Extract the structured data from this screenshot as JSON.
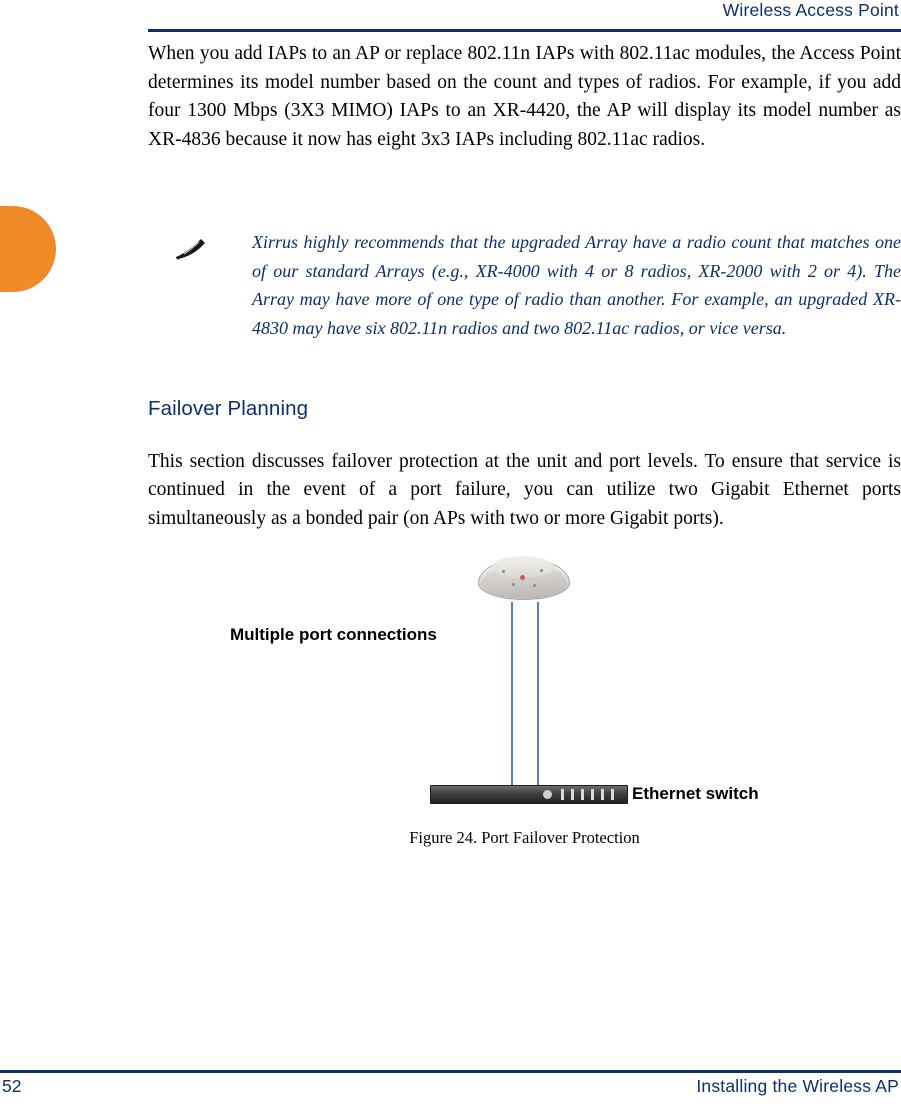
{
  "header": {
    "title": "Wireless Access Point"
  },
  "body": {
    "paragraph1": "When you add IAPs to an AP or replace 802.11n IAPs with 802.11ac modules, the Access Point determines its model number based on the count and types of radios. For example, if you add four 1300 Mbps (3X3 MIMO) IAPs to an XR-4420, the AP will display its model number as XR-4836 because it now has eight 3x3 IAPs including 802.11ac radios.",
    "note": {
      "icon": "pencil-note-icon",
      "text": "Xirrus highly recommends that the upgraded Array have a radio count that matches one of our standard Arrays (e.g., XR-4000 with 4 or 8 radios, XR-2000 with 2 or 4). The Array may have more of one type of radio than another. For example, an upgraded XR-4830 may have six 802.11n radios and two 802.11ac radios, or vice versa."
    },
    "section_heading": "Failover Planning",
    "paragraph2": "This section discusses failover protection at the unit and port levels. To ensure that service is continued in the event of a port failure, you can utilize two Gigabit Ethernet ports simultaneously as a bonded pair (on APs with two or more Gigabit ports)."
  },
  "figure": {
    "label_ports": "Multiple port connections",
    "label_switch": "Ethernet switch",
    "caption": "Figure 24. Port Failover Protection",
    "ap_icon": "wireless-access-point-device",
    "switch_icon": "ethernet-switch-device"
  },
  "footer": {
    "page_number": "52",
    "section": "Installing the Wireless AP"
  },
  "colors": {
    "brand_blue": "#0d2f6e",
    "accent_orange": "#f08a28"
  }
}
